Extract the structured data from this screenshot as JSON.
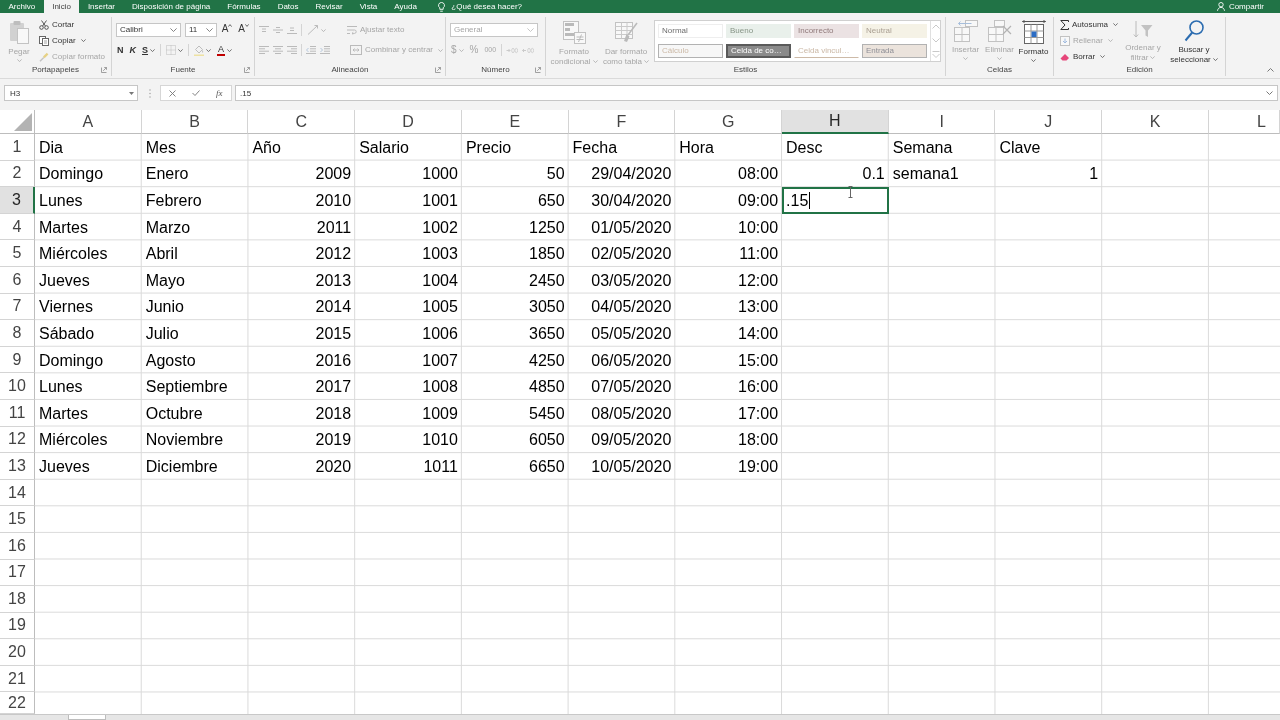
{
  "menu": {
    "tabs": [
      {
        "label": "Archivo",
        "selected": false
      },
      {
        "label": "Inicio",
        "selected": true
      },
      {
        "label": "Insertar",
        "selected": false
      },
      {
        "label": "Disposición de página",
        "selected": false
      },
      {
        "label": "Fórmulas",
        "selected": false
      },
      {
        "label": "Datos",
        "selected": false
      },
      {
        "label": "Revisar",
        "selected": false
      },
      {
        "label": "Vista",
        "selected": false
      },
      {
        "label": "Ayuda",
        "selected": false
      }
    ],
    "tell_me": "¿Qué desea hacer?",
    "share": "Compartir"
  },
  "ribbon": {
    "clipboard": {
      "label": "Portapapeles",
      "paste": {
        "label": "Pegar",
        "disabled": true
      },
      "cut": {
        "label": "Cortar",
        "disabled": false
      },
      "copy": {
        "label": "Copiar",
        "disabled": false
      },
      "format_painter": {
        "label": "Copiar formato",
        "disabled": true
      }
    },
    "font": {
      "label": "Fuente",
      "font_name": "Calibri",
      "font_size": "11",
      "grow_font": "A",
      "shrink_font": "A",
      "bold": "N",
      "italic": "K",
      "underline": "S",
      "font_color": "A"
    },
    "alignment": {
      "label": "Alineación",
      "disabled": true,
      "wrap_text": "Ajustar texto",
      "merge_center": "Combinar y centrar"
    },
    "number": {
      "label": "Número",
      "disabled": true,
      "format": "General",
      "currency": "$",
      "percent": "%",
      "thousands": "000"
    },
    "styles": {
      "label": "Estilos",
      "disabled": true,
      "conditional_format": "Formato condicional",
      "format_as_table": "Dar formato como tabla",
      "gallery": [
        {
          "label": "Normal",
          "kind": "normal"
        },
        {
          "label": "Bueno",
          "kind": "good"
        },
        {
          "label": "Incorrecto",
          "kind": "bad"
        },
        {
          "label": "Neutral",
          "kind": "neutral"
        },
        {
          "label": "Cálculo",
          "kind": "calculation"
        },
        {
          "label": "Celda de co…",
          "kind": "check"
        },
        {
          "label": "Celda vincul…",
          "kind": "linked"
        },
        {
          "label": "Entrada",
          "kind": "input"
        }
      ]
    },
    "cells": {
      "label": "Celdas",
      "insert": {
        "label": "Insertar",
        "disabled": true
      },
      "delete": {
        "label": "Eliminar",
        "disabled": true
      },
      "format": {
        "label": "Formato",
        "disabled": false
      }
    },
    "editing": {
      "label": "Edición",
      "autosum": {
        "label": "Autosuma",
        "disabled": false
      },
      "fill": {
        "label": "Rellenar",
        "disabled": true
      },
      "clear": {
        "label": "Borrar",
        "disabled": false
      },
      "sort_filter": {
        "label": "Ordenar y filtrar",
        "disabled": true
      },
      "find_select": {
        "label": "Buscar y seleccionar",
        "disabled": false
      }
    }
  },
  "formula_bar": {
    "name_box": "H3",
    "function_button": "fx",
    "formula": ".15"
  },
  "sheet": {
    "columns": [
      {
        "label": "A",
        "selected": false
      },
      {
        "label": "B",
        "selected": false
      },
      {
        "label": "C",
        "selected": false
      },
      {
        "label": "D",
        "selected": false
      },
      {
        "label": "E",
        "selected": false
      },
      {
        "label": "F",
        "selected": false
      },
      {
        "label": "G",
        "selected": false
      },
      {
        "label": "H",
        "selected": true
      },
      {
        "label": "I",
        "selected": false
      },
      {
        "label": "J",
        "selected": false
      },
      {
        "label": "K",
        "selected": false
      },
      {
        "label": "L",
        "selected": false
      }
    ],
    "rows": [
      {
        "number": "1",
        "selected": false,
        "cells": [
          {
            "value": "Dia",
            "kind": "text"
          },
          {
            "value": "Mes",
            "kind": "text"
          },
          {
            "value": "Año",
            "kind": "text"
          },
          {
            "value": "Salario",
            "kind": "text"
          },
          {
            "value": "Precio",
            "kind": "text"
          },
          {
            "value": "Fecha",
            "kind": "text"
          },
          {
            "value": "Hora",
            "kind": "text"
          },
          {
            "value": "Desc",
            "kind": "text"
          },
          {
            "value": "Semana",
            "kind": "text"
          },
          {
            "value": "Clave",
            "kind": "text"
          }
        ]
      },
      {
        "number": "2",
        "selected": false,
        "cells": [
          {
            "value": "Domingo",
            "kind": "text"
          },
          {
            "value": "Enero",
            "kind": "text"
          },
          {
            "value": "2009",
            "kind": "number"
          },
          {
            "value": "1000",
            "kind": "number"
          },
          {
            "value": "50",
            "kind": "number"
          },
          {
            "value": "29/04/2020",
            "kind": "number"
          },
          {
            "value": "08:00",
            "kind": "number"
          },
          {
            "value": "0.1",
            "kind": "number"
          },
          {
            "value": "semana1",
            "kind": "text"
          },
          {
            "value": "1",
            "kind": "number"
          }
        ]
      },
      {
        "number": "3",
        "selected": true,
        "cells": [
          {
            "value": "Lunes",
            "kind": "text"
          },
          {
            "value": "Febrero",
            "kind": "text"
          },
          {
            "value": "2010",
            "kind": "number"
          },
          {
            "value": "1001",
            "kind": "number"
          },
          {
            "value": "650",
            "kind": "number"
          },
          {
            "value": "30/04/2020",
            "kind": "number"
          },
          {
            "value": "09:00",
            "kind": "number"
          },
          {
            "value": ".15",
            "kind": "editing"
          }
        ]
      },
      {
        "number": "4",
        "selected": false,
        "cells": [
          {
            "value": "Martes",
            "kind": "text"
          },
          {
            "value": "Marzo",
            "kind": "text"
          },
          {
            "value": "2011",
            "kind": "number"
          },
          {
            "value": "1002",
            "kind": "number"
          },
          {
            "value": "1250",
            "kind": "number"
          },
          {
            "value": "01/05/2020",
            "kind": "number"
          },
          {
            "value": "10:00",
            "kind": "number"
          }
        ]
      },
      {
        "number": "5",
        "selected": false,
        "cells": [
          {
            "value": "Miércoles",
            "kind": "text"
          },
          {
            "value": "Abril",
            "kind": "text"
          },
          {
            "value": "2012",
            "kind": "number"
          },
          {
            "value": "1003",
            "kind": "number"
          },
          {
            "value": "1850",
            "kind": "number"
          },
          {
            "value": "02/05/2020",
            "kind": "number"
          },
          {
            "value": "11:00",
            "kind": "number"
          }
        ]
      },
      {
        "number": "6",
        "selected": false,
        "cells": [
          {
            "value": "Jueves",
            "kind": "text"
          },
          {
            "value": "Mayo",
            "kind": "text"
          },
          {
            "value": "2013",
            "kind": "number"
          },
          {
            "value": "1004",
            "kind": "number"
          },
          {
            "value": "2450",
            "kind": "number"
          },
          {
            "value": "03/05/2020",
            "kind": "number"
          },
          {
            "value": "12:00",
            "kind": "number"
          }
        ]
      },
      {
        "number": "7",
        "selected": false,
        "cells": [
          {
            "value": "Viernes",
            "kind": "text"
          },
          {
            "value": "Junio",
            "kind": "text"
          },
          {
            "value": "2014",
            "kind": "number"
          },
          {
            "value": "1005",
            "kind": "number"
          },
          {
            "value": "3050",
            "kind": "number"
          },
          {
            "value": "04/05/2020",
            "kind": "number"
          },
          {
            "value": "13:00",
            "kind": "number"
          }
        ]
      },
      {
        "number": "8",
        "selected": false,
        "cells": [
          {
            "value": "Sábado",
            "kind": "text"
          },
          {
            "value": "Julio",
            "kind": "text"
          },
          {
            "value": "2015",
            "kind": "number"
          },
          {
            "value": "1006",
            "kind": "number"
          },
          {
            "value": "3650",
            "kind": "number"
          },
          {
            "value": "05/05/2020",
            "kind": "number"
          },
          {
            "value": "14:00",
            "kind": "number"
          }
        ]
      },
      {
        "number": "9",
        "selected": false,
        "cells": [
          {
            "value": "Domingo",
            "kind": "text"
          },
          {
            "value": "Agosto",
            "kind": "text"
          },
          {
            "value": "2016",
            "kind": "number"
          },
          {
            "value": "1007",
            "kind": "number"
          },
          {
            "value": "4250",
            "kind": "number"
          },
          {
            "value": "06/05/2020",
            "kind": "number"
          },
          {
            "value": "15:00",
            "kind": "number"
          }
        ]
      },
      {
        "number": "10",
        "selected": false,
        "cells": [
          {
            "value": "Lunes",
            "kind": "text"
          },
          {
            "value": "Septiembre",
            "kind": "text"
          },
          {
            "value": "2017",
            "kind": "number"
          },
          {
            "value": "1008",
            "kind": "number"
          },
          {
            "value": "4850",
            "kind": "number"
          },
          {
            "value": "07/05/2020",
            "kind": "number"
          },
          {
            "value": "16:00",
            "kind": "number"
          }
        ]
      },
      {
        "number": "11",
        "selected": false,
        "cells": [
          {
            "value": "Martes",
            "kind": "text"
          },
          {
            "value": "Octubre",
            "kind": "text"
          },
          {
            "value": "2018",
            "kind": "number"
          },
          {
            "value": "1009",
            "kind": "number"
          },
          {
            "value": "5450",
            "kind": "number"
          },
          {
            "value": "08/05/2020",
            "kind": "number"
          },
          {
            "value": "17:00",
            "kind": "number"
          }
        ]
      },
      {
        "number": "12",
        "selected": false,
        "cells": [
          {
            "value": "Miércoles",
            "kind": "text"
          },
          {
            "value": "Noviembre",
            "kind": "text"
          },
          {
            "value": "2019",
            "kind": "number"
          },
          {
            "value": "1010",
            "kind": "number"
          },
          {
            "value": "6050",
            "kind": "number"
          },
          {
            "value": "09/05/2020",
            "kind": "number"
          },
          {
            "value": "18:00",
            "kind": "number"
          }
        ]
      },
      {
        "number": "13",
        "selected": false,
        "cells": [
          {
            "value": "Jueves",
            "kind": "text"
          },
          {
            "value": "Diciembre",
            "kind": "text"
          },
          {
            "value": "2020",
            "kind": "number"
          },
          {
            "value": "1011",
            "kind": "number"
          },
          {
            "value": "6650",
            "kind": "number"
          },
          {
            "value": "10/05/2020",
            "kind": "number"
          },
          {
            "value": "19:00",
            "kind": "number"
          }
        ]
      },
      {
        "number": "14",
        "selected": false
      },
      {
        "number": "15",
        "selected": false
      },
      {
        "number": "16",
        "selected": false
      },
      {
        "number": "17",
        "selected": false
      },
      {
        "number": "18",
        "selected": false
      },
      {
        "number": "19",
        "selected": false
      },
      {
        "number": "20",
        "selected": false
      },
      {
        "number": "21",
        "selected": false
      },
      {
        "number": "22",
        "selected": false
      }
    ]
  }
}
